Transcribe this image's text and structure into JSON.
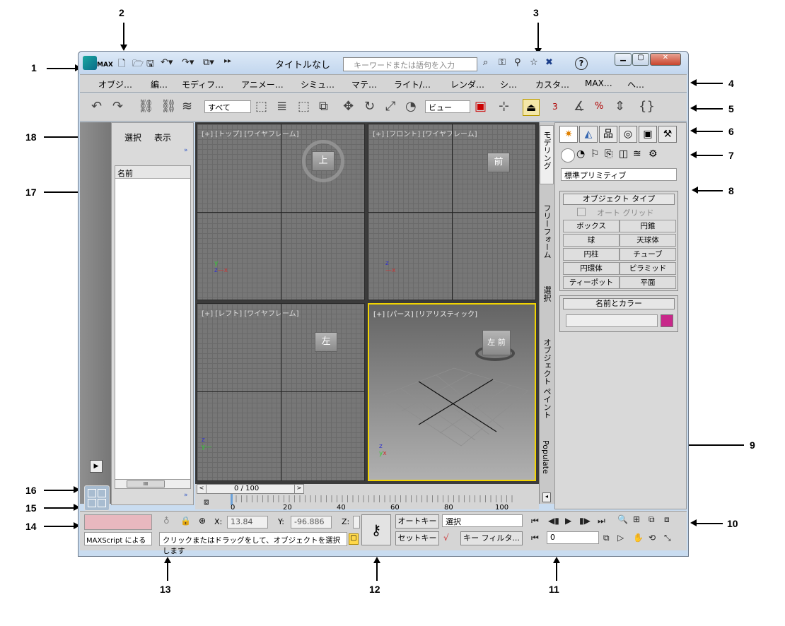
{
  "app": {
    "logo_text": "MAX",
    "title": "タイトルなし",
    "search_placeholder": "キーワードまたは語句を入力",
    "help_label": "?"
  },
  "callouts": [
    "1",
    "2",
    "3",
    "4",
    "5",
    "6",
    "7",
    "8",
    "9",
    "10",
    "11",
    "12",
    "13",
    "14",
    "15",
    "16",
    "17",
    "18"
  ],
  "menus": [
    "オブジ…",
    "編…",
    "モディフ…",
    "アニメー…",
    "シミュ…",
    "マテ…",
    "ライト/…",
    "レンダ…",
    "シ…",
    "カスタ…",
    "MAX…",
    "ヘ…"
  ],
  "toolbar": {
    "selection_filter": "すべて",
    "ref_coord": "ビュー",
    "snap3": "3",
    "percent": "%"
  },
  "scene": {
    "tab_select": "選択",
    "tab_display": "表示",
    "column_name": "名前",
    "scroll_mark": "III"
  },
  "viewports": [
    {
      "label": "[+] [トップ] [ワイヤフレーム]",
      "cube": "上"
    },
    {
      "label": "[+] [フロント] [ワイヤフレーム]",
      "cube": "前"
    },
    {
      "label": "[+] [レフト] [ワイヤフレーム]",
      "cube": "左"
    },
    {
      "label": "[+] [パース] [リアリスティック]",
      "cube": "左 前"
    }
  ],
  "ribbon_tabs": [
    "モデリング",
    "フリーフォーム",
    "選択",
    "オブジェクト ペイント",
    "Populate"
  ],
  "panel": {
    "category": "標準プリミティブ",
    "object_type_title": "オブジェクト タイプ",
    "autogrid": "オート グリッド",
    "buttons": [
      "ボックス",
      "円錐",
      "球",
      "天球体",
      "円柱",
      "チューブ",
      "円環体",
      "ピラミッド",
      "ティーポット",
      "平面"
    ],
    "name_color_title": "名前とカラー",
    "color": "#c8288a"
  },
  "timeline": {
    "frame": "0 / 100",
    "ticks": [
      "0",
      "20",
      "40",
      "60",
      "80",
      "100"
    ]
  },
  "status": {
    "maxscript": "MAXScript による",
    "prompt": "クリックまたはドラッグをして、オブジェクトを選択します",
    "x_label": "X:",
    "x_value": "13.84",
    "y_label": "Y:",
    "y_value": "-96.886",
    "z_label": "Z:",
    "autokey": "オートキー",
    "setkey": "セットキー",
    "key_mode": "選択",
    "key_filter": "キー フィルタ...",
    "frame_value": "0"
  }
}
